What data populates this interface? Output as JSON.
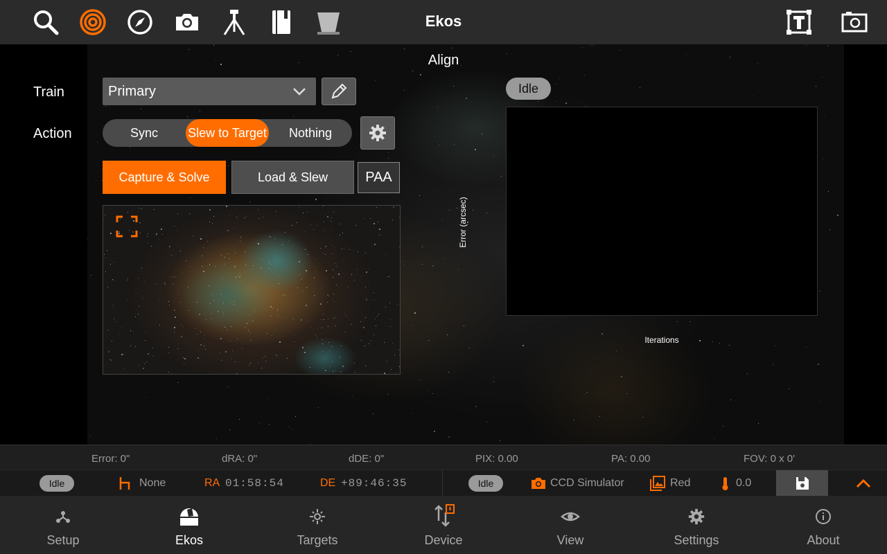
{
  "header": {
    "title": "Ekos",
    "icons": [
      "search-icon",
      "target-icon",
      "compass-icon",
      "camera-icon",
      "tripod-icon",
      "notebook-icon",
      "flat-panel-icon",
      "text-frame-icon",
      "screenshot-icon"
    ]
  },
  "align": {
    "title": "Align",
    "train_label": "Train",
    "train_value": "Primary",
    "action_label": "Action",
    "actions": [
      "Sync",
      "Slew to Target",
      "Nothing"
    ],
    "active_action": "Slew to Target",
    "capture_solve_label": "Capture & Solve",
    "load_slew_label": "Load & Slew",
    "paa_label": "PAA",
    "status": "Idle",
    "plot": {
      "y_label": "Error (arcsec)",
      "x_label": "Iterations"
    }
  },
  "stats": {
    "error": "Error: 0\"",
    "dra": "dRA: 0\"",
    "dde": "dDE: 0\"",
    "pix": "PIX: 0.00",
    "pa": "PA: 0.00",
    "fov": "FOV: 0 x 0'"
  },
  "statusbar": {
    "mount_status": "Idle",
    "park": "None",
    "ra_label": "RA",
    "ra_value": "01:58:54",
    "de_label": "DE",
    "de_value": "+89:46:35",
    "camera_status": "Idle",
    "camera": "CCD Simulator",
    "filter": "Red",
    "temperature": "0.0"
  },
  "nav": {
    "items": [
      {
        "label": "Setup",
        "icon": "setup-icon"
      },
      {
        "label": "Ekos",
        "icon": "observatory-icon"
      },
      {
        "label": "Targets",
        "icon": "targets-icon"
      },
      {
        "label": "Device",
        "icon": "device-icon"
      },
      {
        "label": "View",
        "icon": "view-icon"
      },
      {
        "label": "Settings",
        "icon": "settings-icon"
      },
      {
        "label": "About",
        "icon": "about-icon"
      }
    ],
    "active": "Ekos"
  },
  "colors": {
    "accent": "#ff6d00",
    "topbar": "#2b2b2b",
    "nav": "#262626"
  }
}
